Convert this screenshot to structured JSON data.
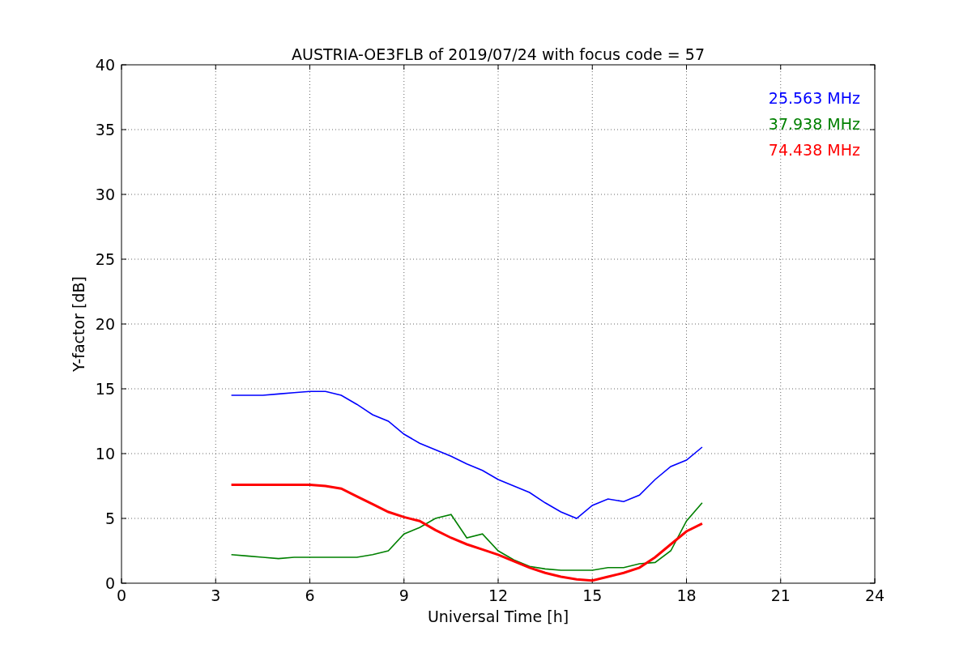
{
  "chart_data": {
    "type": "line",
    "title": "AUSTRIA-OE3FLB of 2019/07/24 with focus code = 57",
    "xlabel": "Universal Time [h]",
    "ylabel": "Y-factor [dB]",
    "x": [
      3.5,
      4,
      4.5,
      5,
      5.5,
      6,
      6.5,
      7,
      7.5,
      8,
      8.5,
      9,
      9.5,
      10,
      10.5,
      11,
      11.5,
      12,
      12.5,
      13,
      13.5,
      14,
      14.5,
      15,
      15.5,
      16,
      16.5,
      17,
      17.5,
      18,
      18.5
    ],
    "series": [
      {
        "name": "25.563 MHz",
        "color": "#0000ff",
        "values": [
          14.5,
          14.5,
          14.5,
          14.6,
          14.7,
          14.8,
          14.8,
          14.5,
          13.8,
          13,
          12.5,
          11.5,
          10.8,
          10.3,
          9.8,
          9.2,
          8.7,
          8,
          7.5,
          7,
          6.2,
          5.5,
          5,
          6,
          6.5,
          6.3,
          6.8,
          8,
          9,
          9.5,
          10.5
        ]
      },
      {
        "name": "37.938 MHz",
        "color": "#008000",
        "values": [
          2.2,
          2.1,
          2,
          1.9,
          2,
          2,
          2,
          2,
          2,
          2.2,
          2.5,
          3.8,
          4.3,
          5,
          5.3,
          3.5,
          3.8,
          2.5,
          1.8,
          1.3,
          1.1,
          1,
          1,
          1,
          1.2,
          1.2,
          1.5,
          1.6,
          2.5,
          4.8,
          6.2
        ]
      },
      {
        "name": "74.438 MHz",
        "color": "#ff0000",
        "values": [
          7.6,
          7.6,
          7.6,
          7.6,
          7.6,
          7.6,
          7.5,
          7.3,
          6.7,
          6.1,
          5.5,
          5.1,
          4.8,
          4.1,
          3.5,
          3,
          2.6,
          2.2,
          1.7,
          1.2,
          0.8,
          0.5,
          0.3,
          0.2,
          0.5,
          0.8,
          1.2,
          2,
          3,
          4,
          4.6
        ]
      }
    ],
    "grid": true,
    "xlim": [
      0,
      24
    ],
    "ylim": [
      0,
      40
    ],
    "xticks": [
      0,
      3,
      6,
      9,
      12,
      15,
      18,
      21,
      24
    ],
    "yticks": [
      0,
      5,
      10,
      15,
      20,
      25,
      30,
      35,
      40
    ]
  }
}
